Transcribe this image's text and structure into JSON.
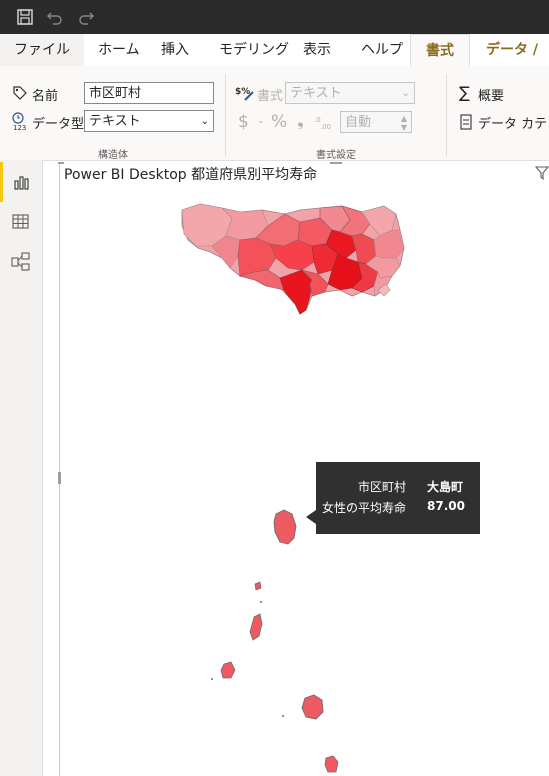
{
  "quick_access": {
    "icons": [
      "save-icon",
      "undo-icon",
      "redo-icon"
    ]
  },
  "ribbon_tabs": [
    {
      "label": "ファイル"
    },
    {
      "label": "ホーム"
    },
    {
      "label": "挿入"
    },
    {
      "label": "モデリング"
    },
    {
      "label": "表示"
    },
    {
      "label": "ヘルプ"
    },
    {
      "label": "書式"
    },
    {
      "label": "データ / ドリ"
    }
  ],
  "ribbon": {
    "structure": {
      "name_label": "名前",
      "name_value": "市区町村",
      "datatype_label": "データ型",
      "datatype_value": "テキスト",
      "group_label": "構造体"
    },
    "format": {
      "format_label": "書式",
      "format_value": "テキスト",
      "currency_symbol": "$",
      "percent_symbol": "%",
      "comma_symbol": "❟",
      "decimal_value": "自動",
      "group_label": "書式設定"
    },
    "properties": {
      "summary_label": "概要",
      "data_category_label": "データ カテゴ"
    }
  },
  "left_nav": {
    "icons": [
      "report-view-icon",
      "data-view-icon",
      "model-view-icon"
    ],
    "active": "report-view-icon"
  },
  "visual": {
    "title": "Power BI Desktop 都道府県別平均寿命"
  },
  "tooltip": {
    "rows": [
      {
        "key": "市区町村",
        "value": "大島町"
      },
      {
        "key": "女性の平均寿命",
        "value": "87.00"
      }
    ]
  },
  "colors": {
    "accent_gold": "#8a6d1e",
    "map_light": "#f2a3a8",
    "map_mid": "#f25c64",
    "map_dark": "#e8141e"
  }
}
